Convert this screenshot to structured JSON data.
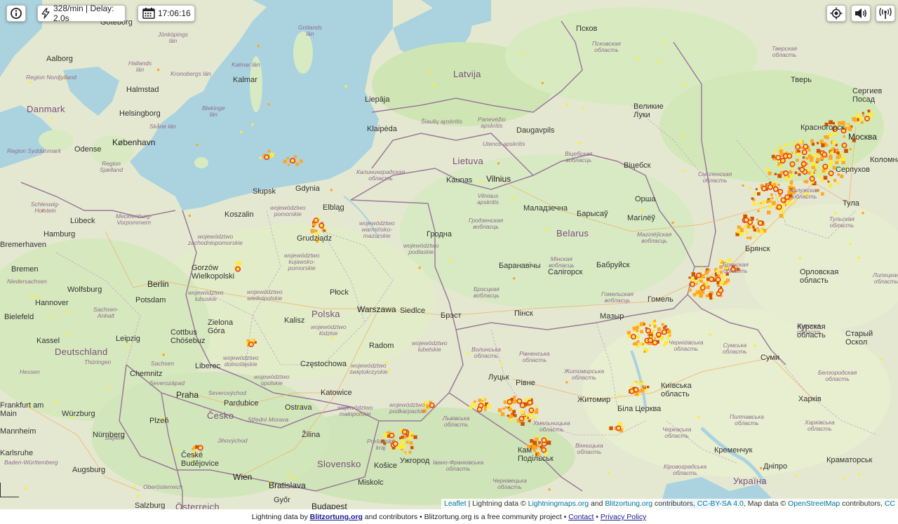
{
  "toolbar": {
    "info_icon": "info-icon",
    "rate_text": "328/min | Delay: 2.0s",
    "time_text": "17:06:16",
    "locate_icon": "locate-icon",
    "sound_icon": "speaker-icon",
    "signal_icon": "signal-icon"
  },
  "labels": {
    "countries": {
      "danmark": "Danmark",
      "deutschland": "Deutschland",
      "polska": "Polska",
      "latvija": "Latvija",
      "lietuva": "Lietuva",
      "belarus": "Belarus",
      "cesko": "Česko",
      "slovensko": "Slovensko",
      "ukraina": "Україна",
      "osterreich": "Österreich"
    },
    "cities": {
      "goteborg": "Göteborg",
      "aalborg": "Aalborg",
      "halmstad": "Halmstad",
      "helsingborg": "Helsingborg",
      "kobenhavn": "København",
      "odense": "Odense",
      "kalmar": "Kalmar",
      "lubeck": "Lübeck",
      "hamburg": "Hamburg",
      "bremerhaven": "Bremerhaven",
      "bremen": "Bremen",
      "wolfsburg": "Wolfsburg",
      "hannover": "Hannover",
      "berlin": "Berlin",
      "potsdam": "Potsdam",
      "bielefeld": "Bielefeld",
      "kassel": "Kassel",
      "leipzig": "Leipzig",
      "chemnitz": "Chemnitz",
      "frankfurt": "Frankfurt am\nMain",
      "wurzburg": "Würzburg",
      "nurnberg": "Nürnberg",
      "mannheim": "Mannheim",
      "karlsruhe": "Karlsruhe",
      "augsburg": "Augsburg",
      "salzburg": "Salzburg",
      "wien": "Wien",
      "bratislava": "Bratislava",
      "gyor": "Győr",
      "budapest": "Budapest",
      "miskolc": "Miskolc",
      "kosice": "Košice",
      "uzhorod": "Ужгород",
      "ceske": "České\nBudějovice",
      "praha": "Praha",
      "plzen": "Plzeň",
      "pardubice": "Pardubice",
      "liberec": "Liberec",
      "ostrava": "Ostrava",
      "zilina": "Žilina",
      "katowice": "Katowice",
      "czestochowa": "Częstochowa",
      "radom": "Radom",
      "warszawa": "Warszawa",
      "siedlce": "Siedlce",
      "plock": "Płock",
      "kalisz": "Kalisz",
      "zielona": "Zielona\nGóra",
      "cottbus": "Cottbus\nChóśebuz",
      "gorzow": "Gorzów\nWielkopolski",
      "koszalin": "Koszalin",
      "slupsk": "Słupsk",
      "gdynia": "Gdynia",
      "elblag": "Elbląg",
      "grudziadz": "Grudziądz",
      "liepaja": "Liepāja",
      "klaipeda": "Klaipėda",
      "kaunas": "Kaunas",
      "vilnius": "Vilnius",
      "daugavpils": "Daugavpils",
      "hrodna": "Гродна",
      "brest": "Брэст",
      "pinsk": "Пінск",
      "baranavichy": "Баранавічы",
      "maladzechna": "Маладзечна",
      "barysau": "Барысаў",
      "mahilyow": "Магілёў",
      "orsha": "Орша",
      "vitsebsk": "Віцебск",
      "salihorsk": "Салігорск",
      "babruisk": "Бабруйск",
      "homel": "Гомель",
      "mazyr": "Мазыр",
      "lutsk": "Луцьк",
      "rivne": "Рівне",
      "zhytomyr": "Житомир",
      "bila": "Біла Церква",
      "kamianets": "Кам\nПодільськ",
      "kyiv_o": "Київська\nобласть",
      "pskov": "Псков",
      "velikie": "Великие\nЛуки",
      "tver": "Тверь",
      "sergiev": "Сергиев\nПосад",
      "krasnogorsk": "Красногорск",
      "moskva": "Москва",
      "bryansk": "Брянск",
      "tula": "Тула",
      "kursk": "Курская\nобласть",
      "sumy": "Суми",
      "kharkiv": "Харків",
      "kremenchuk": "Кременчук",
      "dnipro": "Дніпро",
      "kramatorsk": "Краматорськ",
      "stary": "Старый\nОскол",
      "orel": "Орловская\nобласть",
      "kolomna": "Коломна",
      "serpukhov": "Серпухов"
    },
    "regions": {
      "pomorskie": "województwo\npomorskie",
      "zachodnio": "województwo\nzachodniopomorskie",
      "warminsko": "województwo\nwarmińsko-\nmazurskie",
      "kujawsko": "województwo\nkujawsko-\npomorskie",
      "lubuskie": "województwo\nlubuskie",
      "wielkopolskie": "województwo\nwielkopolskie",
      "podlaskie": "województwo\npodlaskie",
      "lodzkie": "województwo\nłódzkie",
      "lubelskie": "województwo\nlubelskie",
      "dolnoslaskie": "województwo\ndolnośląskie",
      "opolskie": "województwo\nopolskie",
      "swietokrzyskie": "województwo\nświętokrzyskie",
      "malopolskie": "województwo\nmałopolskie",
      "podkarpackie": "województwo\npodkarpackie",
      "kaliningrad": "Калининградская\nобласть",
      "grodno": "Гродзенская\nвобласць",
      "brest_o": "Брэсцкая\nвобласць",
      "minsk_o": "Мінская\nвобласць",
      "vitebsk_o": "Віцебская\nвобласць",
      "mogilev_o": "Магілёўская\nвобласць",
      "gomel_o": "Гомельская\nвобласць",
      "volyn": "Волинська\nобласть",
      "rivne_o": "Рівненська\nобласть",
      "zhytomyr_o": "Житомирська\nобласть",
      "chernihiv_o": "Чернігівська\nобласть",
      "sumy_o": "Сумська\nобласть",
      "poltava_o": "Полтавська\nобласть",
      "kharkiv_o": "Харківська\nобласть",
      "cherkasy_o": "Черкаська\nобласть",
      "vinnytsia_o": "Вінницька\nобласть",
      "kirov_o": "Кіровоградська\nобласть",
      "smolensk_o": "Смоленская\nобласть",
      "bryansk_o": "Брянская\nобласть",
      "tula_o": "Тульская\nобласть",
      "kaluga_o": "Калужская\nобласть",
      "pskov_o": "Псковская\nобласть",
      "tver_o": "Тверская\nобласть",
      "lipetsk_o": "Липецкая\nобласть",
      "belgorod_o": "Белгородская\nобласть",
      "vilnius_a": "Vilniaus\napskritis",
      "utenos": "Utenos apskritis",
      "siauliu": "Šiaulių apskritis",
      "panevezio": "Panevėžio\napskritis",
      "kalmar_lan": "Kalmar län",
      "skane": "Skåne län",
      "blekinge": "Blekinge\nlän",
      "kronoberg": "Kronobergs län",
      "hallands": "Hallands\nlän",
      "jonkoping": "Jönköpings\nlän",
      "gotlands": "Gotlands\nlän",
      "nordjylland": "Region Nordjylland",
      "syddanmark": "Region Syddanmark",
      "sjaelland": "Region\nSjælland",
      "schleswig": "Schleswig-\nHolstein",
      "mecklenburg": "Mecklenburg-\nVorpommern",
      "niedersachsen": "Niedersachsen",
      "sachsen_anhalt": "Sachsen-\nAnhalt",
      "sachsen": "Sachsen",
      "thuringen": "Thüringen",
      "hessen": "Hessen",
      "bayern": "Bayern",
      "baden": "Baden-Württemberg",
      "oberosterreich": "Oberösterreich",
      "stredni": "Střední Morava",
      "severo": "Severozápad",
      "severovychod": "Severovýchod",
      "jihovychod": "Jihovýchod",
      "presov": "Prešovský\nkraj",
      "ivano": "Івано-Франківська\nобласть",
      "chernivtsi": "Чернівецька\nобласть",
      "khmel": "Хмельницька\nобласть",
      "lviv_o": "Львівська\nобласть",
      "kursk_o": "Курская\nобласть"
    }
  },
  "attribution": {
    "leaflet": "Leaflet",
    "text1": " | Lightning data © ",
    "lightningmaps": "Lightningmaps.org",
    "and": " and ",
    "blitzortung": "Blitzortung.org",
    "contributors": " contributors, ",
    "ccbysa": "CC-BY-SA 4.0",
    "mapdata": ", Map data © ",
    "osm": "OpenStreetMap",
    "contributors2": " contributors, ",
    "cc": "CC"
  },
  "footer": {
    "prefix": "Lightning data by ",
    "blitzortung": "Blitzortung.org",
    "middle": " and contributors • Blitzortung.org is a free community project • ",
    "contact": "Contact",
    "sep": " • ",
    "privacy": "Privacy Policy"
  },
  "strike_colors": {
    "recent": "#ffeb3b",
    "mid": "#ffa726",
    "old": "#d35400",
    "ring": "#e53935"
  }
}
